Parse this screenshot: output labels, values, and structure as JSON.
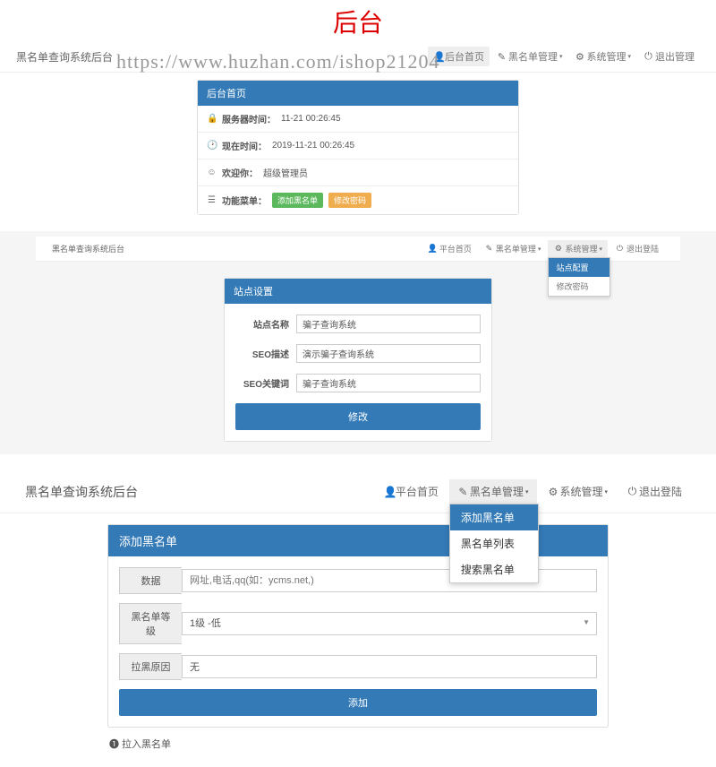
{
  "big_title": "后台",
  "watermark": "https://www.huzhan.com/ishop21204",
  "s1": {
    "brand": "黑名单查询系统后台",
    "nav": {
      "home": "后台首页",
      "black": "黑名单管理",
      "sys": "系统管理",
      "logout": "退出管理"
    },
    "panel_title": "后台首页",
    "row1_label": "服务器时间：",
    "row1_val": "11-21 00:26:45",
    "row2_label": "现在时间：",
    "row2_val": "2019-11-21 00:26:45",
    "row3_label": "欢迎你：",
    "row3_val": "超级管理员",
    "row4_label": "功能菜单：",
    "btn1": "添加黑名单",
    "btn2": "修改密码"
  },
  "s2": {
    "brand": "黑名单查询系统后台",
    "nav": {
      "home": "平台首页",
      "black": "黑名单管理",
      "sys": "系统管理",
      "logout": "退出登陆"
    },
    "dd": {
      "a": "站点配置",
      "b": "修改密码"
    },
    "panel_title": "站点设置",
    "f1_label": "站点名称",
    "f1_val": "骗子查询系统",
    "f2_label": "SEO描述",
    "f2_val": "演示骗子查询系统",
    "f3_label": "SEO关键词",
    "f3_val": "骗子查询系统",
    "submit": "修改"
  },
  "s3": {
    "brand": "黑名单查询系统后台",
    "nav": {
      "home": "平台首页",
      "black": "黑名单管理",
      "sys": "系统管理",
      "logout": "退出登陆"
    },
    "dd": {
      "a": "添加黑名单",
      "b": "黑名单列表",
      "c": "搜索黑名单"
    },
    "panel_title": "添加黑名单",
    "f1_label": "数据",
    "f1_ph": "网址,电话,qq(如：ycms.net,)",
    "f2_label": "黑名单等级",
    "f2_val": "1级 -低",
    "f3_label": "拉黑原因",
    "f3_val": "无",
    "submit": "添加",
    "extra": "❶ 拉入黑名单"
  }
}
